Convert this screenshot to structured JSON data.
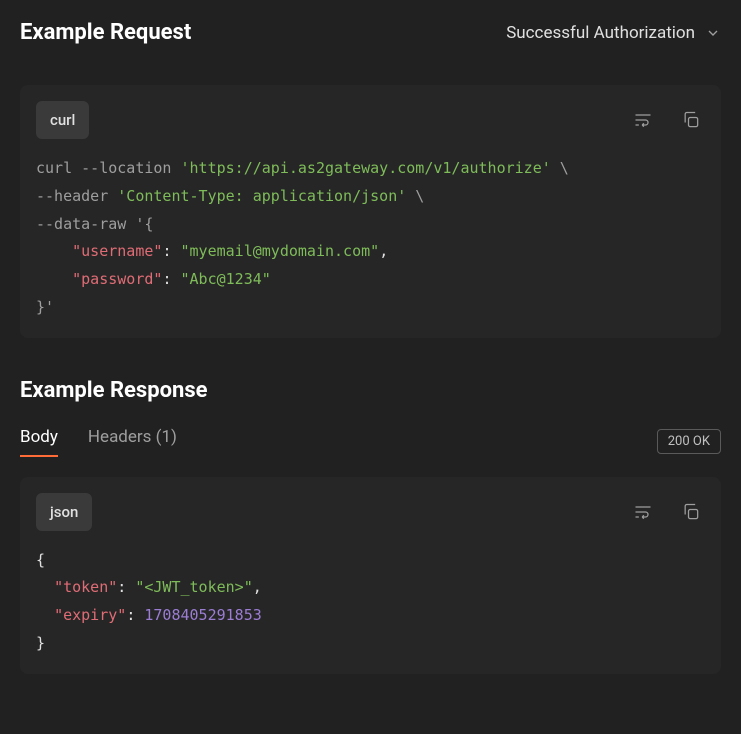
{
  "request": {
    "title": "Example Request",
    "dropdown_label": "Successful Authorization",
    "lang_badge": "curl",
    "code": {
      "cmd": "curl",
      "flag_location": "--location",
      "url": "'https://api.as2gateway.com/v1/authorize'",
      "backslash": "\\",
      "flag_header": "--header",
      "header_val": "'Content-Type: application/json'",
      "flag_dataraw": "--data-raw",
      "body_open": "'{",
      "key_username": "\"username\"",
      "val_username": "\"myemail@mydomain.com\"",
      "key_password": "\"password\"",
      "val_password": "\"Abc@1234\"",
      "body_close": "}'",
      "comma": ",",
      "colon": ":"
    }
  },
  "response": {
    "title": "Example Response",
    "tabs": {
      "body": "Body",
      "headers": "Headers (1)"
    },
    "status": "200 OK",
    "lang_badge": "json",
    "code": {
      "open": "{",
      "key_token": "\"token\"",
      "val_token": "\"<JWT_token>\"",
      "key_expiry": "\"expiry\"",
      "val_expiry": "1708405291853",
      "close": "}",
      "colon": ":",
      "comma": ","
    }
  }
}
